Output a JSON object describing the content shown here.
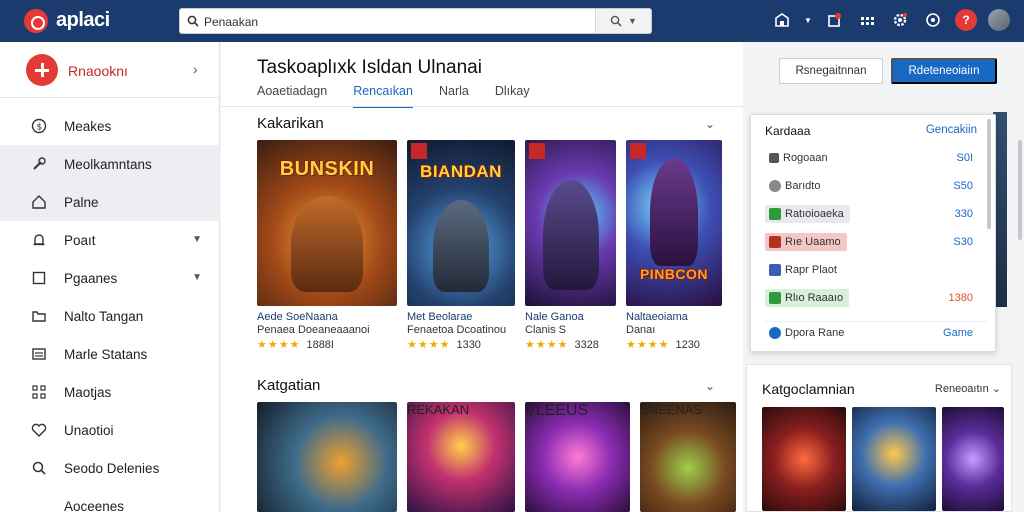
{
  "topbar": {
    "logo_text": "aplaci",
    "search_value": "Penaakan"
  },
  "sidebar": {
    "brand_name": "Rnaooknı",
    "items": [
      {
        "label": "Meakes",
        "icon": "coin-icon"
      },
      {
        "label": "Meolkamntans",
        "icon": "wrench-icon"
      },
      {
        "label": "Palne",
        "icon": "home-icon"
      },
      {
        "label": "Poaıt",
        "icon": "bell-icon"
      },
      {
        "label": "Pgaanes",
        "icon": "square-icon"
      },
      {
        "label": "Nalto Tangan",
        "icon": "folder-icon"
      },
      {
        "label": "Marle Statans",
        "icon": "list-icon"
      },
      {
        "label": "Maotjas",
        "icon": "grid-icon"
      },
      {
        "label": "Unaotioi",
        "icon": "heart-icon"
      },
      {
        "label": "Seodo Delenies",
        "icon": "search-icon"
      },
      {
        "label": "Aoceenes",
        "icon": "more-icon"
      }
    ]
  },
  "main": {
    "title": "Taskoaplıxk Isldan Ulnanai",
    "tabs": [
      "Aoaetiadagn",
      "Rencaıkan",
      "Narla",
      "Dlıkay"
    ],
    "active_tab": 1,
    "section1_title": "Kakarikan",
    "section2_title": "Katgatian",
    "cards": [
      {
        "art": "BUNSKIN",
        "name": "Aede SoeNaana",
        "sub": "Penaea Doeaneaaanoi",
        "rating": "1888I"
      },
      {
        "art": "BIANDAN",
        "name": "Met Beolarae",
        "sub": "Fenaetoa Dcoatinou",
        "rating": "1330"
      },
      {
        "art": "",
        "name": "Nale Ganoa",
        "sub": "Clanis S",
        "rating": "3328"
      },
      {
        "art": "PINBCON",
        "name": "Naltaeoiama",
        "sub": "Danaı",
        "rating": "1230"
      }
    ],
    "cards2": [
      {
        "art": ""
      },
      {
        "art": "REKAKAN"
      },
      {
        "art": "VLEEUS"
      },
      {
        "art": "SNEENAS"
      }
    ]
  },
  "right": {
    "btn_outline": "Rsnegaitnnan",
    "btn_primary": "Rdeteneoiaiın",
    "dropdown": {
      "head": "Kardaaa",
      "head_link": "Gencakiin",
      "items": [
        {
          "label": "Rogoaan",
          "value": "S0I",
          "icon": "controller-icon",
          "chip": "none"
        },
        {
          "label": "Barıdto",
          "value": "S50",
          "icon": "cloud-icon",
          "chip": "none"
        },
        {
          "label": "Ratıoioaeka",
          "value": "330",
          "icon": "green-icon",
          "chip": "grey"
        },
        {
          "label": "Rıe Uaamo",
          "value": "S30",
          "icon": "red-icon",
          "chip": "red"
        },
        {
          "label": "Rapr Plaot",
          "value": "",
          "icon": "puzzle-icon",
          "chip": "none"
        },
        {
          "label": "Rlıo Raaaıo",
          "value": "1380",
          "icon": "green-icon",
          "chip": "green"
        },
        {
          "label": "Dpora Rane",
          "value": "Game",
          "icon": "globe-icon",
          "chip": "none"
        }
      ]
    },
    "panel_title": "Katgoclamnian",
    "panel_sort": "Reneoaıtın"
  },
  "colors": {
    "topbar": "#1b3b6f",
    "accent": "#1769c4",
    "brand_red": "#e53935",
    "star": "#f2a900"
  }
}
